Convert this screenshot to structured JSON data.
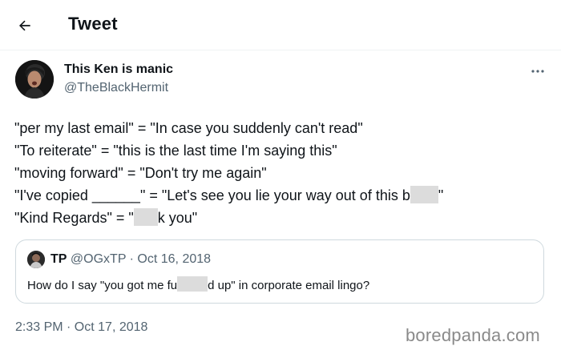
{
  "header": {
    "title": "Tweet",
    "back_icon": "arrow-left-icon"
  },
  "tweet": {
    "author": {
      "display_name": "This Ken is manic",
      "handle": "@TheBlackHermit"
    },
    "more_icon": "more-horizontal-icon",
    "lines": [
      "\"per my last email\" = \"In case you suddenly can't read\"",
      "\"To reiterate\" = \"this is the last time I'm saying this\"",
      "\"moving forward\" = \"Don't try me again\"",
      "\"I've copied ______\" = \"Let's see you lie your way out of this b",
      "\"",
      "\"Kind Regards\" = \"",
      "k you\""
    ],
    "timestamp": "2:33 PM · Oct 17, 2018"
  },
  "quote": {
    "display_name": "TP",
    "handle": "@OGxTP",
    "separator": " · ",
    "date": "Oct 16, 2018",
    "text_before": "How do I say \"you got me fu",
    "text_after": "d up\" in corporate email lingo?"
  },
  "watermark": "boredpanda.com",
  "colors": {
    "text": "#0f1419",
    "secondary": "#536471",
    "border": "#cfd9de",
    "censor": "#dcdcdc"
  }
}
